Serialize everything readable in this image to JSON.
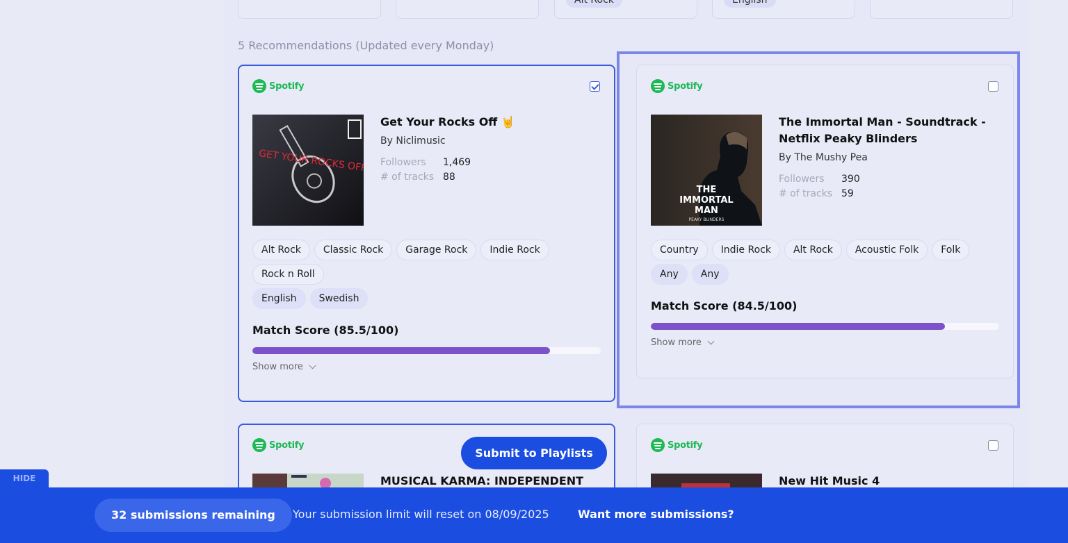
{
  "top_cards": {
    "tag_3": "Alt Rock",
    "tag_4": "English"
  },
  "section_title": "5 Recommendations (Updated every Monday)",
  "spotify_word": "Spotify",
  "cards": [
    {
      "title": "Get Your Rocks Off 🤘",
      "by": "By Niclimusic",
      "followers_label": "Followers",
      "followers": "1,469",
      "tracks_label": "# of tracks",
      "tracks": "88",
      "genres": [
        "Alt Rock",
        "Classic Rock",
        "Garage Rock",
        "Indie Rock",
        "Rock n Roll"
      ],
      "languages": [
        "English",
        "Swedish"
      ],
      "match_label": "Match Score (85.5/100)",
      "match_score": 85.5,
      "show_more": "Show more",
      "checked": true,
      "cover_text": "GET YOUR ROCKS OFF"
    },
    {
      "title": "The Immortal Man - Soundtrack - Netflix Peaky Blinders",
      "by": "By The Mushy Pea",
      "followers_label": "Followers",
      "followers": "390",
      "tracks_label": "# of tracks",
      "tracks": "59",
      "genres": [
        "Country",
        "Indie Rock",
        "Alt Rock",
        "Acoustic Folk",
        "Folk"
      ],
      "languages": [
        "Any",
        "Any"
      ],
      "match_label": "Match Score (84.5/100)",
      "match_score": 84.5,
      "show_more": "Show more",
      "checked": false,
      "cover_text_1": "THE",
      "cover_text_2": "IMMORTAL",
      "cover_text_3": "MAN",
      "cover_text_4": "PEAKY BLINDERS"
    },
    {
      "title": "MUSICAL KARMA: INDEPENDENT MIX",
      "checked": true
    },
    {
      "title": "New Hit Music 4",
      "checked": false
    }
  ],
  "submit_button": "Submit to Playlists",
  "hide_label": "HIDE",
  "footer": {
    "remaining": "32 submissions remaining",
    "reset_text": "Your submission limit will reset on 08/09/2025",
    "more_link": "Want more submissions?"
  },
  "colors": {
    "accent": "#1a4de0",
    "match_bar": "#7b52c9",
    "spotify_green": "#1db954",
    "selected_border": "#3b5bdb"
  }
}
